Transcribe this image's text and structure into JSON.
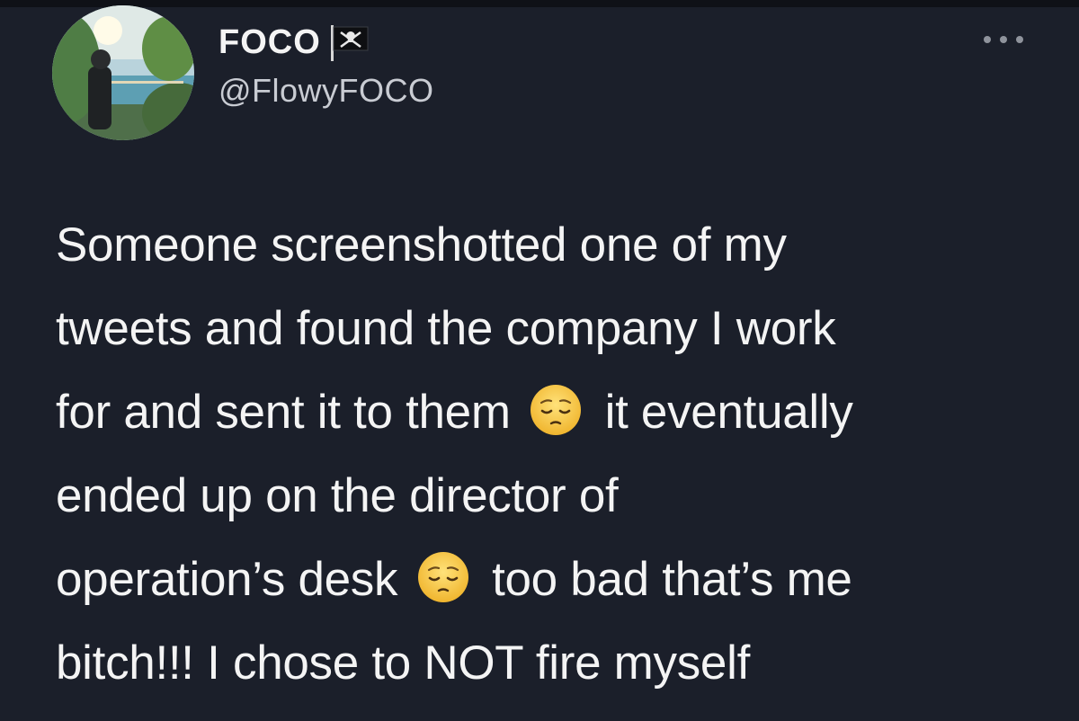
{
  "tweet": {
    "display_name": "FOCO",
    "flag_icon": "pirate-flag-icon",
    "handle": "@FlowyFOCO",
    "more_icon": "more-options-icon",
    "lines": [
      {
        "text": "Someone screenshotted one of my"
      },
      {
        "text": "tweets and found the company I work"
      },
      {
        "before": "for and sent it to them",
        "emoji": "pensive-face-emoji",
        "after": "it eventually"
      },
      {
        "text": "ended up on the director of"
      },
      {
        "before": "operation’s desk",
        "emoji": "pensive-face-emoji",
        "after": "too bad that’s me"
      },
      {
        "text": "bitch!!! I chose to NOT fire myself"
      }
    ]
  },
  "colors": {
    "background": "#1b1f2a",
    "text": "#f4f4f4",
    "handle": "#c9ccd3",
    "emoji": "#f7c844"
  }
}
